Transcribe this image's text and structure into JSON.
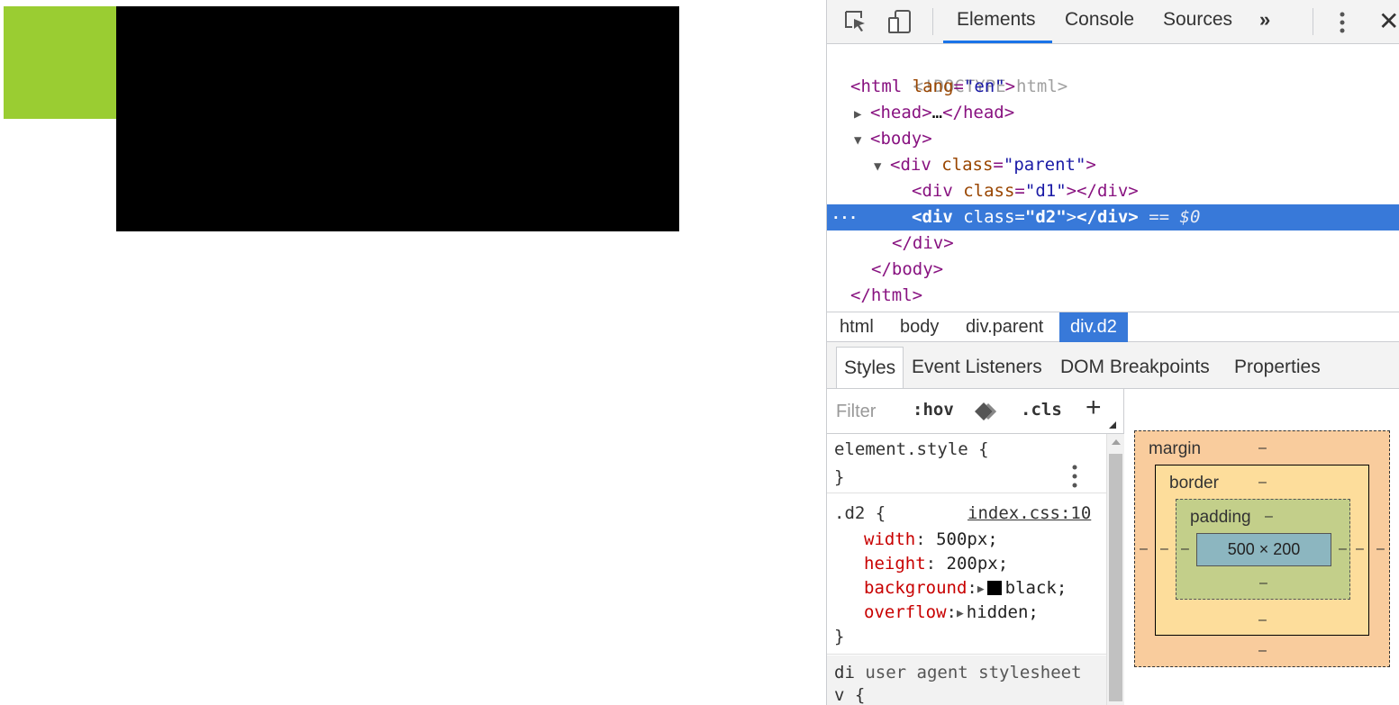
{
  "page": {
    "green_color": "#9acd32",
    "black_color": "#000000"
  },
  "devtools": {
    "toolbar": {
      "tabs": [
        {
          "label": "Elements"
        },
        {
          "label": "Console"
        },
        {
          "label": "Sources"
        }
      ],
      "more_label": "»",
      "close_label": "✕"
    },
    "dom": {
      "doctype": "<!DOCTYPE html>",
      "html_open": {
        "tag_open": "<html",
        "attr": "lang",
        "eq": "=",
        "val": "\"en\"",
        "close": ">"
      },
      "head": {
        "tag": "<head>",
        "ellipsis": "…",
        "close": "</head>"
      },
      "body_open": "<body>",
      "parent_div": {
        "tag_open": "<div",
        "attr": "class",
        "eq": "=",
        "val": "\"parent\"",
        "close": ">"
      },
      "d1_div": {
        "tag_open": "<div",
        "attr": "class",
        "eq": "=",
        "val": "\"d1\"",
        "close": ">",
        "end": "</div>"
      },
      "d2_div": {
        "tag_open": "<div",
        "attr": "class",
        "eq": "=",
        "val": "\"d2\"",
        "close": ">",
        "end": "</div>",
        "suffix": "== $0"
      },
      "div_close": "</div>",
      "body_close": "</body>",
      "html_close": "</html>",
      "row_menu": "···"
    },
    "breadcrumb": [
      "html",
      "body",
      "div.parent",
      "div.d2"
    ],
    "subtabs": [
      "Styles",
      "Event Listeners",
      "DOM Breakpoints",
      "Properties"
    ],
    "filter": {
      "placeholder": "Filter",
      "hov": ":hov",
      "cls": ".cls",
      "add": "+"
    },
    "rules": {
      "element_style": {
        "selector": "element.style {",
        "close": "}"
      },
      "d2": {
        "selector": ".d2 {",
        "source": "index.css:10",
        "props": [
          {
            "name": "width",
            "value": "500px;"
          },
          {
            "name": "height",
            "value": "200px;"
          },
          {
            "name": "background",
            "value": "black;"
          },
          {
            "name": "overflow",
            "value": "hidden;"
          }
        ],
        "close": "}"
      },
      "ua": {
        "selector_part1": "di",
        "label": "user agent stylesheet",
        "selector_part2": "v {"
      }
    },
    "box_model": {
      "margin_label": "margin",
      "border_label": "border",
      "padding_label": "padding",
      "content": "500 × 200",
      "dash": "–",
      "colors": {
        "margin": "#f9cc9d",
        "border": "#fddd9b",
        "padding": "#c3cf8a",
        "content": "#8cb6c0"
      }
    }
  }
}
